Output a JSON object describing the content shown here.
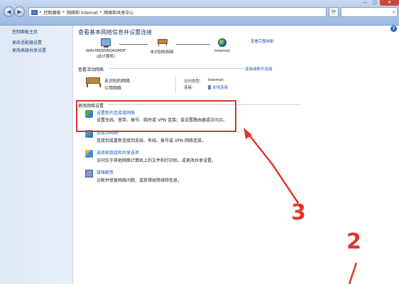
{
  "window": {
    "controls": {
      "minimize": "—",
      "maximize": "□",
      "close": "✕"
    }
  },
  "address_bar": {
    "crumbs": [
      "控制面板",
      "网络和 Internet",
      "网络和共享中心"
    ],
    "separator": "▸"
  },
  "sidebar": {
    "items": [
      {
        "label": "控制面板主页"
      },
      {
        "label": "更改适配器设置"
      },
      {
        "label": "更改高级共享设置"
      }
    ]
  },
  "main": {
    "title": "查看基本网络信息并设置连接",
    "full_map_link": "查看完整映射",
    "help": "?",
    "network_map": {
      "computer": {
        "line1": "WIN-MKB5RQAOM0F",
        "line2": "(此计算机)"
      },
      "network": {
        "label": "未识别的网络"
      },
      "internet": {
        "label": "Internet"
      }
    },
    "active_section": {
      "heading": "查看活动网络",
      "connect_link": "连接或断开连接",
      "network_name": "未识别的网络",
      "network_type": "公用网络",
      "access_type_label": "访问类型:",
      "access_type_value": "Internet",
      "connections_label": "连接:",
      "connections_value": "本地连接"
    },
    "change_section": {
      "heading": "更改网络设置",
      "tasks": [
        {
          "title": "设置新的连接或网络",
          "desc": "设置无线、宽带、拨号、临时或 VPN 连接；或设置路由器或访问点。"
        },
        {
          "title": "连接到网络",
          "desc": "连接到或重新连接到无线、有线、拨号或 VPN 网络连接。"
        },
        {
          "title": "选择家庭组和共享选项",
          "desc": "访问位于其他网络计算机上的文件和打印机，或更改共享设置。"
        },
        {
          "title": "疑难解答",
          "desc": "诊断并修复网络问题，或获得故障排除信息。"
        }
      ]
    }
  },
  "annotations": {
    "label_3": "3",
    "label_2": "2",
    "color": "#e0352b"
  }
}
